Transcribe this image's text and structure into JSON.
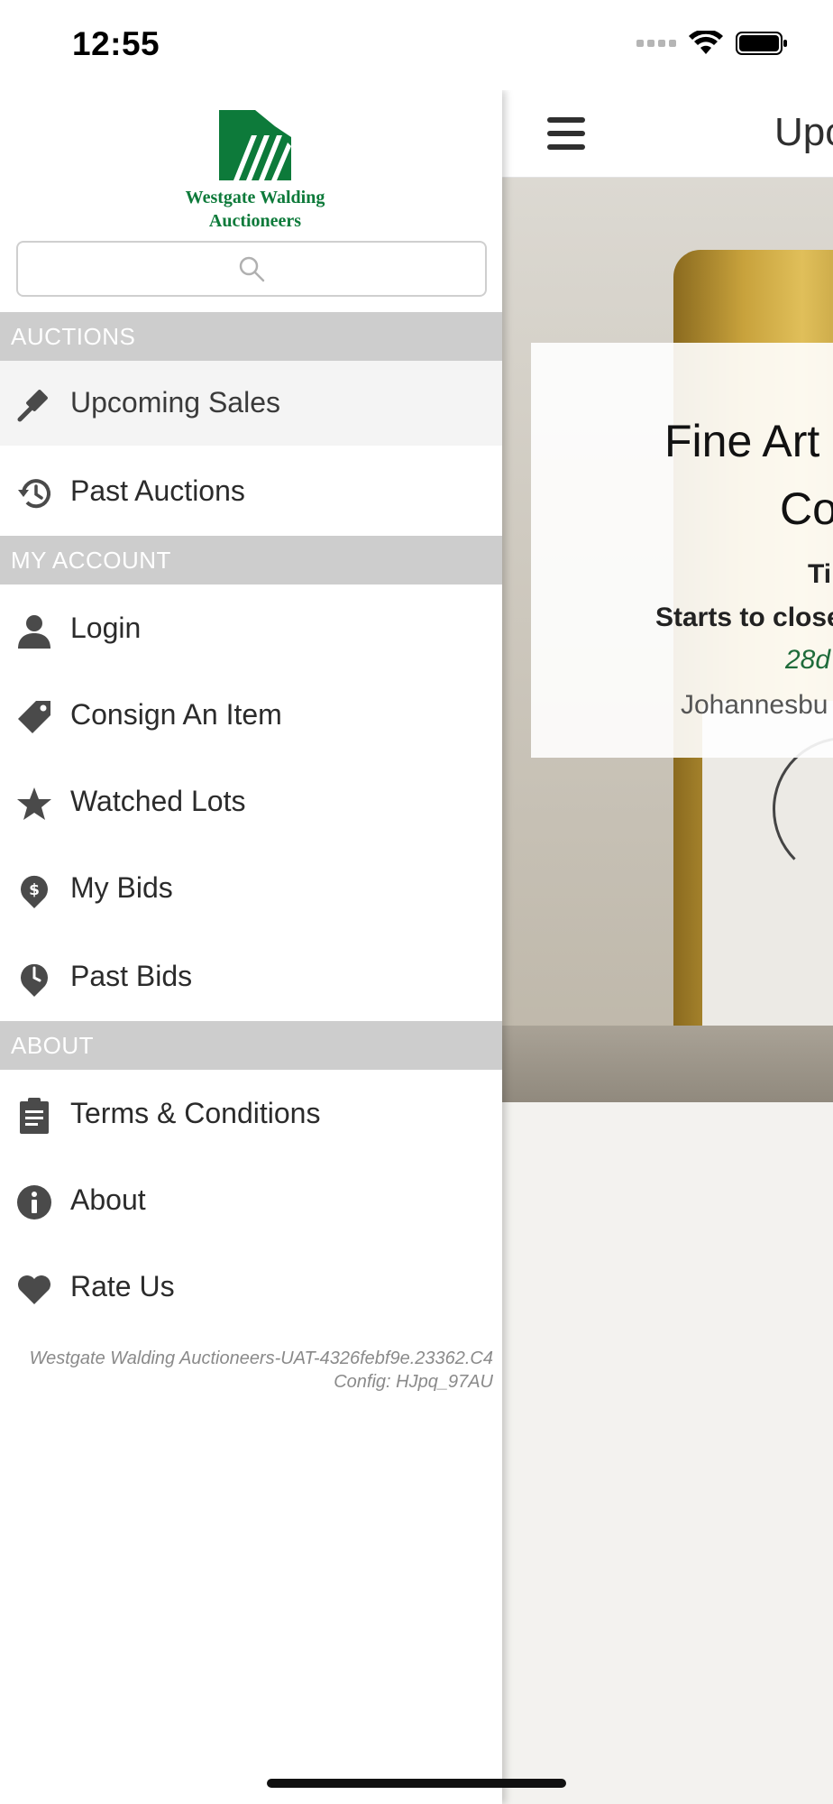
{
  "status_bar": {
    "time": "12:55"
  },
  "main": {
    "title": "Upc",
    "card": {
      "title_line1": "Fine Art",
      "title_line2": "Co",
      "line1": "Ti",
      "line2": "Starts to close",
      "line3": "28d",
      "line4": "Johannesbu"
    }
  },
  "drawer": {
    "logo_text": "Westgate Walding Auctioneers",
    "sections": {
      "auctions": "AUCTIONS",
      "my_account": "MY ACCOUNT",
      "about": "ABOUT"
    },
    "items": {
      "upcoming_sales": "Upcoming Sales",
      "past_auctions": "Past Auctions",
      "login": "Login",
      "consign": "Consign An Item",
      "watched": "Watched Lots",
      "my_bids": "My Bids",
      "past_bids": "Past Bids",
      "terms": "Terms & Conditions",
      "about": "About",
      "rate_us": "Rate Us"
    },
    "version_line1": "Westgate Walding Auctioneers-UAT-4326febf9e.23362.C4",
    "version_line2": "Config: HJpq_97AU"
  },
  "colors": {
    "brand_green": "#0d7a3a",
    "section_header": "#cdcdcd",
    "accent_italic": "#1e6b3a"
  }
}
